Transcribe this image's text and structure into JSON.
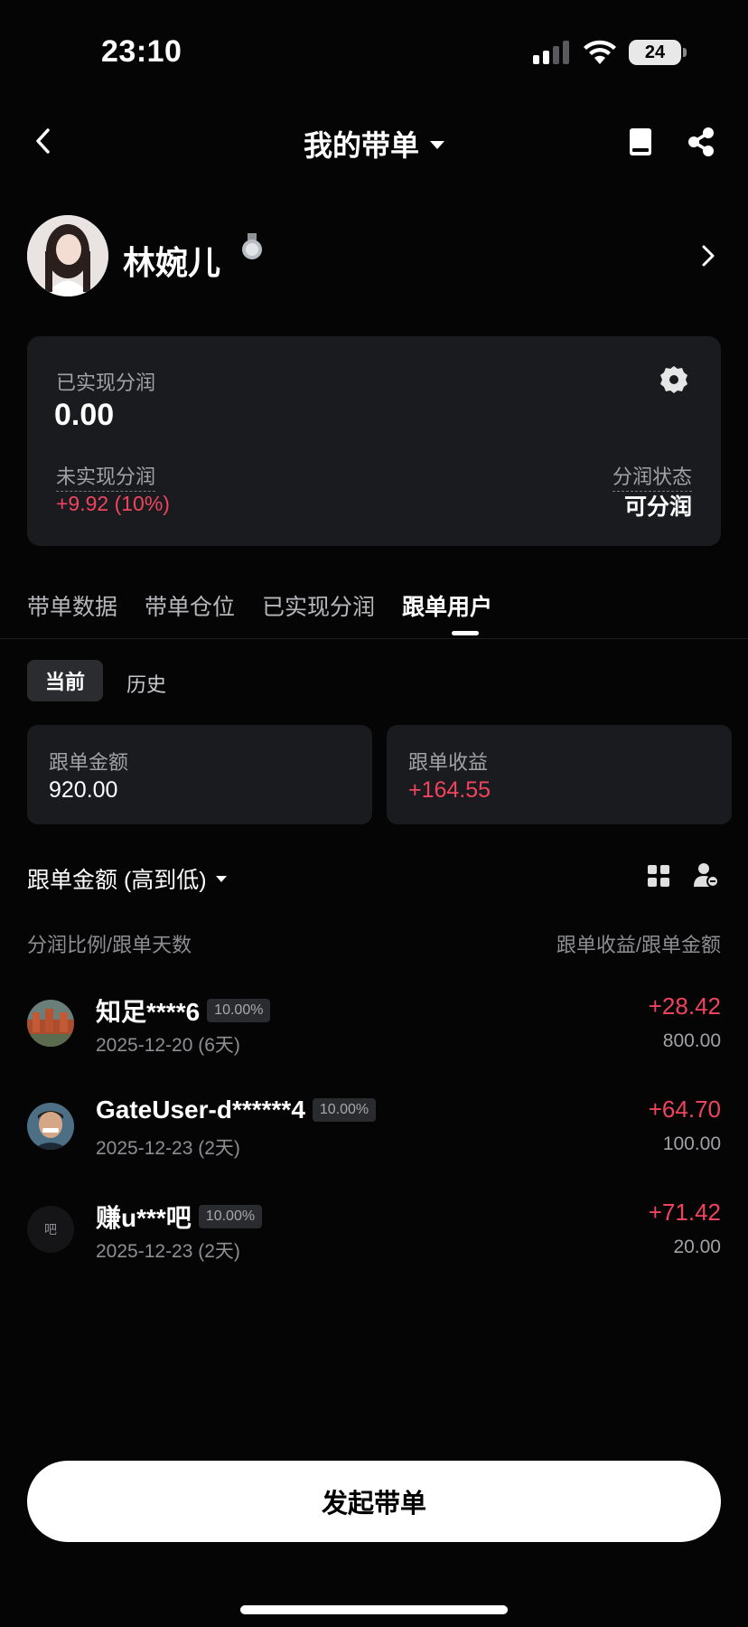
{
  "status_bar": {
    "time": "23:10",
    "battery": "24"
  },
  "nav": {
    "title": "我的带单"
  },
  "profile": {
    "name": "林婉儿"
  },
  "card": {
    "realized_label": "已实现分润",
    "realized_value": "0.00",
    "unrealized_label": "未实现分润",
    "unrealized_value": "+9.92 (10%)",
    "status_label": "分润状态",
    "status_value": "可分润"
  },
  "tabs": [
    {
      "label": "带单数据",
      "active": false
    },
    {
      "label": "带单仓位",
      "active": false
    },
    {
      "label": "已实现分润",
      "active": false
    },
    {
      "label": "跟单用户",
      "active": true
    }
  ],
  "subtabs": {
    "current": "当前",
    "history": "历史"
  },
  "summary": {
    "amount_label": "跟单金额",
    "amount_value": "920.00",
    "profit_label": "跟单收益",
    "profit_value": "+164.55"
  },
  "sort": {
    "label": "跟单金额 (高到低)"
  },
  "columns": {
    "left": "分润比例/跟单天数",
    "right": "跟单收益/跟单金额"
  },
  "followers": [
    {
      "name": "知足****6",
      "ratio": "10.00%",
      "date": "2025-12-20 (6天)",
      "profit": "+28.42",
      "amount": "800.00"
    },
    {
      "name": "GateUser-d******4",
      "ratio": "10.00%",
      "date": "2025-12-23 (2天)",
      "profit": "+64.70",
      "amount": "100.00"
    },
    {
      "name": "赚u***吧",
      "ratio": "10.00%",
      "date": "2025-12-23 (2天)",
      "profit": "+71.42",
      "amount": "20.00",
      "avatar_text": "吧"
    }
  ],
  "bottom": {
    "button_label": "发起带单"
  },
  "colors": {
    "accent_red": "#f0445e",
    "card_bg": "#1a1b1e",
    "page_bg": "#050505"
  }
}
